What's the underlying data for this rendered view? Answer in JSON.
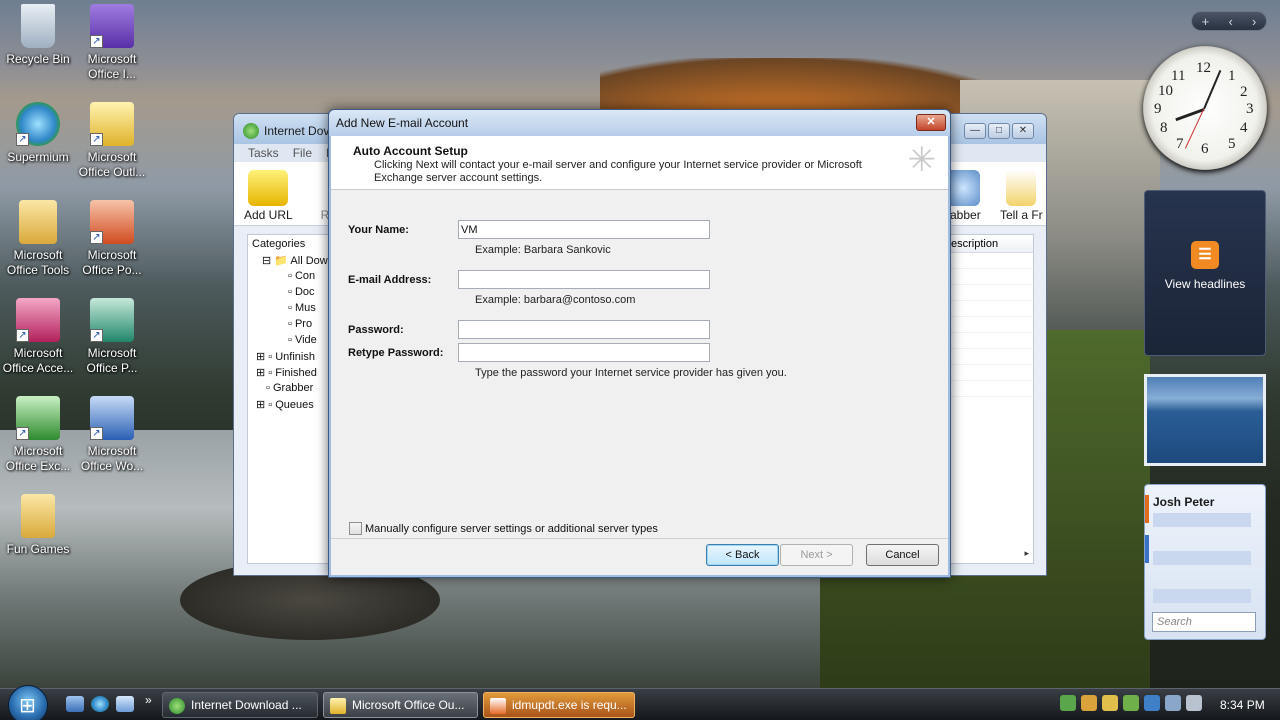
{
  "desktop": {
    "icons": [
      {
        "label": "Recycle Bin"
      },
      {
        "label": "Microsoft Office I..."
      },
      {
        "label": "Supermium"
      },
      {
        "label": "Microsoft Office Outl..."
      },
      {
        "label": "Microsoft Office Tools"
      },
      {
        "label": "Microsoft Office Po..."
      },
      {
        "label": "Microsoft Office Acce..."
      },
      {
        "label": "Microsoft Office P..."
      },
      {
        "label": "Microsoft Office Exc..."
      },
      {
        "label": "Microsoft Office Wo..."
      },
      {
        "label": "Fun Games"
      }
    ]
  },
  "gadgets": {
    "bar": {
      "add": "+",
      "prev": "‹",
      "next": "›"
    },
    "clock_numbers": [
      "12",
      "1",
      "2",
      "3",
      "4",
      "5",
      "6",
      "7",
      "8",
      "9",
      "10",
      "11"
    ],
    "feed_label": "View headlines",
    "feed_icon": "rss-icon",
    "contacts_name": "Josh Peter",
    "contacts_search": "Search"
  },
  "idm": {
    "title": "Internet Dov",
    "menu": [
      "Tasks",
      "File",
      "D"
    ],
    "toolbar": {
      "add_url": "Add URL",
      "r": "R",
      "grabber": "rabber",
      "tell": "Tell a Fr"
    },
    "categories_header": "Categories",
    "categories": [
      "All Dowr",
      "Con",
      "Doc",
      "Mus",
      "Pro",
      "Vide",
      "Unfinish",
      "Finished",
      "Grabber",
      "Queues"
    ],
    "list_header": "escription"
  },
  "dialog": {
    "title": "Add New E-mail Account",
    "close": "✕",
    "header_title": "Auto Account Setup",
    "header_desc": "Clicking Next will contact your e-mail server and configure your Internet service provider or Microsoft Exchange server account settings.",
    "name_label": "Your Name:",
    "name_value": "VM",
    "name_hint": "Example: Barbara Sankovic",
    "email_label": "E-mail Address:",
    "email_value": "",
    "email_hint": "Example: barbara@contoso.com",
    "password_label": "Password:",
    "retype_label": "Retype Password:",
    "password_hint": "Type the password your Internet service provider has given you.",
    "manual_config": "Manually configure server settings or additional server types",
    "back": "< Back",
    "next": "Next >",
    "cancel": "Cancel"
  },
  "taskbar": {
    "tasks": [
      {
        "label": "Internet Download ..."
      },
      {
        "label": "Microsoft Office Ou..."
      },
      {
        "label": "idmupdt.exe is requ..."
      }
    ],
    "overflow": "»",
    "time": "8:34 PM"
  }
}
